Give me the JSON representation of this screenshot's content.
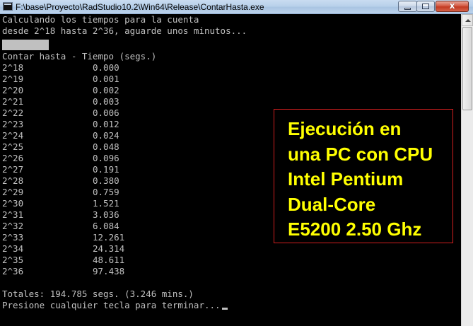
{
  "window": {
    "title": "F:\\base\\Proyecto\\RadStudio10.2\\Win64\\Release\\ContarHasta.exe",
    "icon": "console-app-icon",
    "controls": {
      "minimize_icon": "minimize-icon",
      "maximize_icon": "maximize-icon",
      "close_glyph": "x"
    }
  },
  "console": {
    "intro_line_1": "Calculando los tiempos para la cuenta",
    "intro_line_2": "desde 2^18 hasta 2^36, aguarde unos minutos...",
    "table_header": "Contar hasta - Tiempo (segs.)",
    "rows": [
      {
        "power": "2^18",
        "time": "0.000"
      },
      {
        "power": "2^19",
        "time": "0.001"
      },
      {
        "power": "2^20",
        "time": "0.002"
      },
      {
        "power": "2^21",
        "time": "0.003"
      },
      {
        "power": "2^22",
        "time": "0.006"
      },
      {
        "power": "2^23",
        "time": "0.012"
      },
      {
        "power": "2^24",
        "time": "0.024"
      },
      {
        "power": "2^25",
        "time": "0.048"
      },
      {
        "power": "2^26",
        "time": "0.096"
      },
      {
        "power": "2^27",
        "time": "0.191"
      },
      {
        "power": "2^28",
        "time": "0.380"
      },
      {
        "power": "2^29",
        "time": "0.759"
      },
      {
        "power": "2^30",
        "time": "1.521"
      },
      {
        "power": "2^31",
        "time": "3.036"
      },
      {
        "power": "2^32",
        "time": "6.084"
      },
      {
        "power": "2^33",
        "time": "12.261"
      },
      {
        "power": "2^34",
        "time": "24.314"
      },
      {
        "power": "2^35",
        "time": "48.611"
      },
      {
        "power": "2^36",
        "time": "97.438"
      }
    ],
    "totals": "Totales: 194.785 segs. (3.246 mins.)",
    "prompt": "Presione cualquier tecla para terminar..."
  },
  "annotation": {
    "text": "Ejecución en\nuna PC con CPU\nIntel Pentium\nDual-Core\nE5200 2.50 Ghz",
    "text_color": "#ffff00",
    "border_color": "#d11f1f"
  },
  "colors": {
    "console_bg": "#000000",
    "console_fg": "#c0c0c0"
  }
}
